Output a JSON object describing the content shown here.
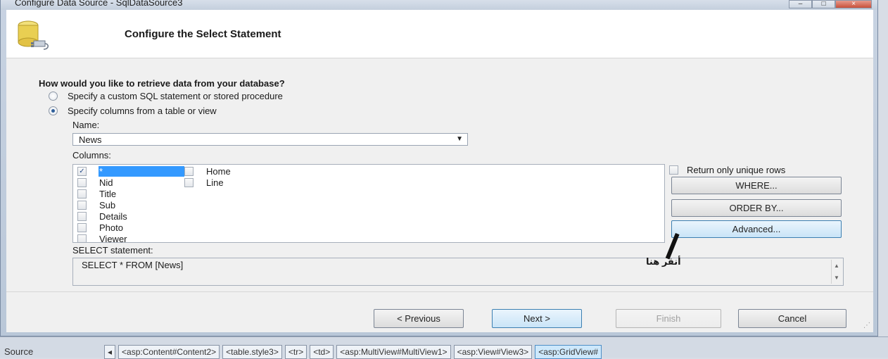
{
  "window": {
    "title": "Configure Data Source - SqlDataSource3"
  },
  "header": {
    "title": "Configure the Select Statement"
  },
  "main": {
    "question": "How would you like to retrieve data from your database?",
    "options": [
      {
        "label": "Specify a custom SQL statement or stored procedure",
        "checked": false
      },
      {
        "label": "Specify columns from a table or view",
        "checked": true
      }
    ],
    "name_label": "Name:",
    "name_value": "News",
    "columns_label": "Columns:",
    "columns": [
      {
        "name": "*",
        "checked": true
      },
      {
        "name": "Nid",
        "checked": false
      },
      {
        "name": "Title",
        "checked": false
      },
      {
        "name": "Sub",
        "checked": false
      },
      {
        "name": "Details",
        "checked": false
      },
      {
        "name": "Photo",
        "checked": false
      },
      {
        "name": "Viewer",
        "checked": false
      },
      {
        "name": "Home",
        "checked": false
      },
      {
        "name": "Line",
        "checked": false
      }
    ],
    "unique_rows_label": "Return only unique rows",
    "where_label": "WHERE...",
    "orderby_label": "ORDER BY...",
    "advanced_label": "Advanced...",
    "select_label": "SELECT statement:",
    "select_value": "SELECT * FROM [News]",
    "annotation": "أنقر هنا"
  },
  "footer": {
    "previous_label": "< Previous",
    "next_label": "Next >",
    "finish_label": "Finish",
    "cancel_label": "Cancel"
  },
  "statusbar": {
    "source_label": "Source",
    "crumbs": [
      "<asp:Content#Content2>",
      "<table.style3>",
      "<tr>",
      "<td>",
      "<asp:MultiView#MultiView1>",
      "<asp:View#View3>",
      "<asp:GridView#"
    ]
  },
  "colors": {
    "selection": "#3399ff",
    "accent_button": "#3c7fb1"
  }
}
